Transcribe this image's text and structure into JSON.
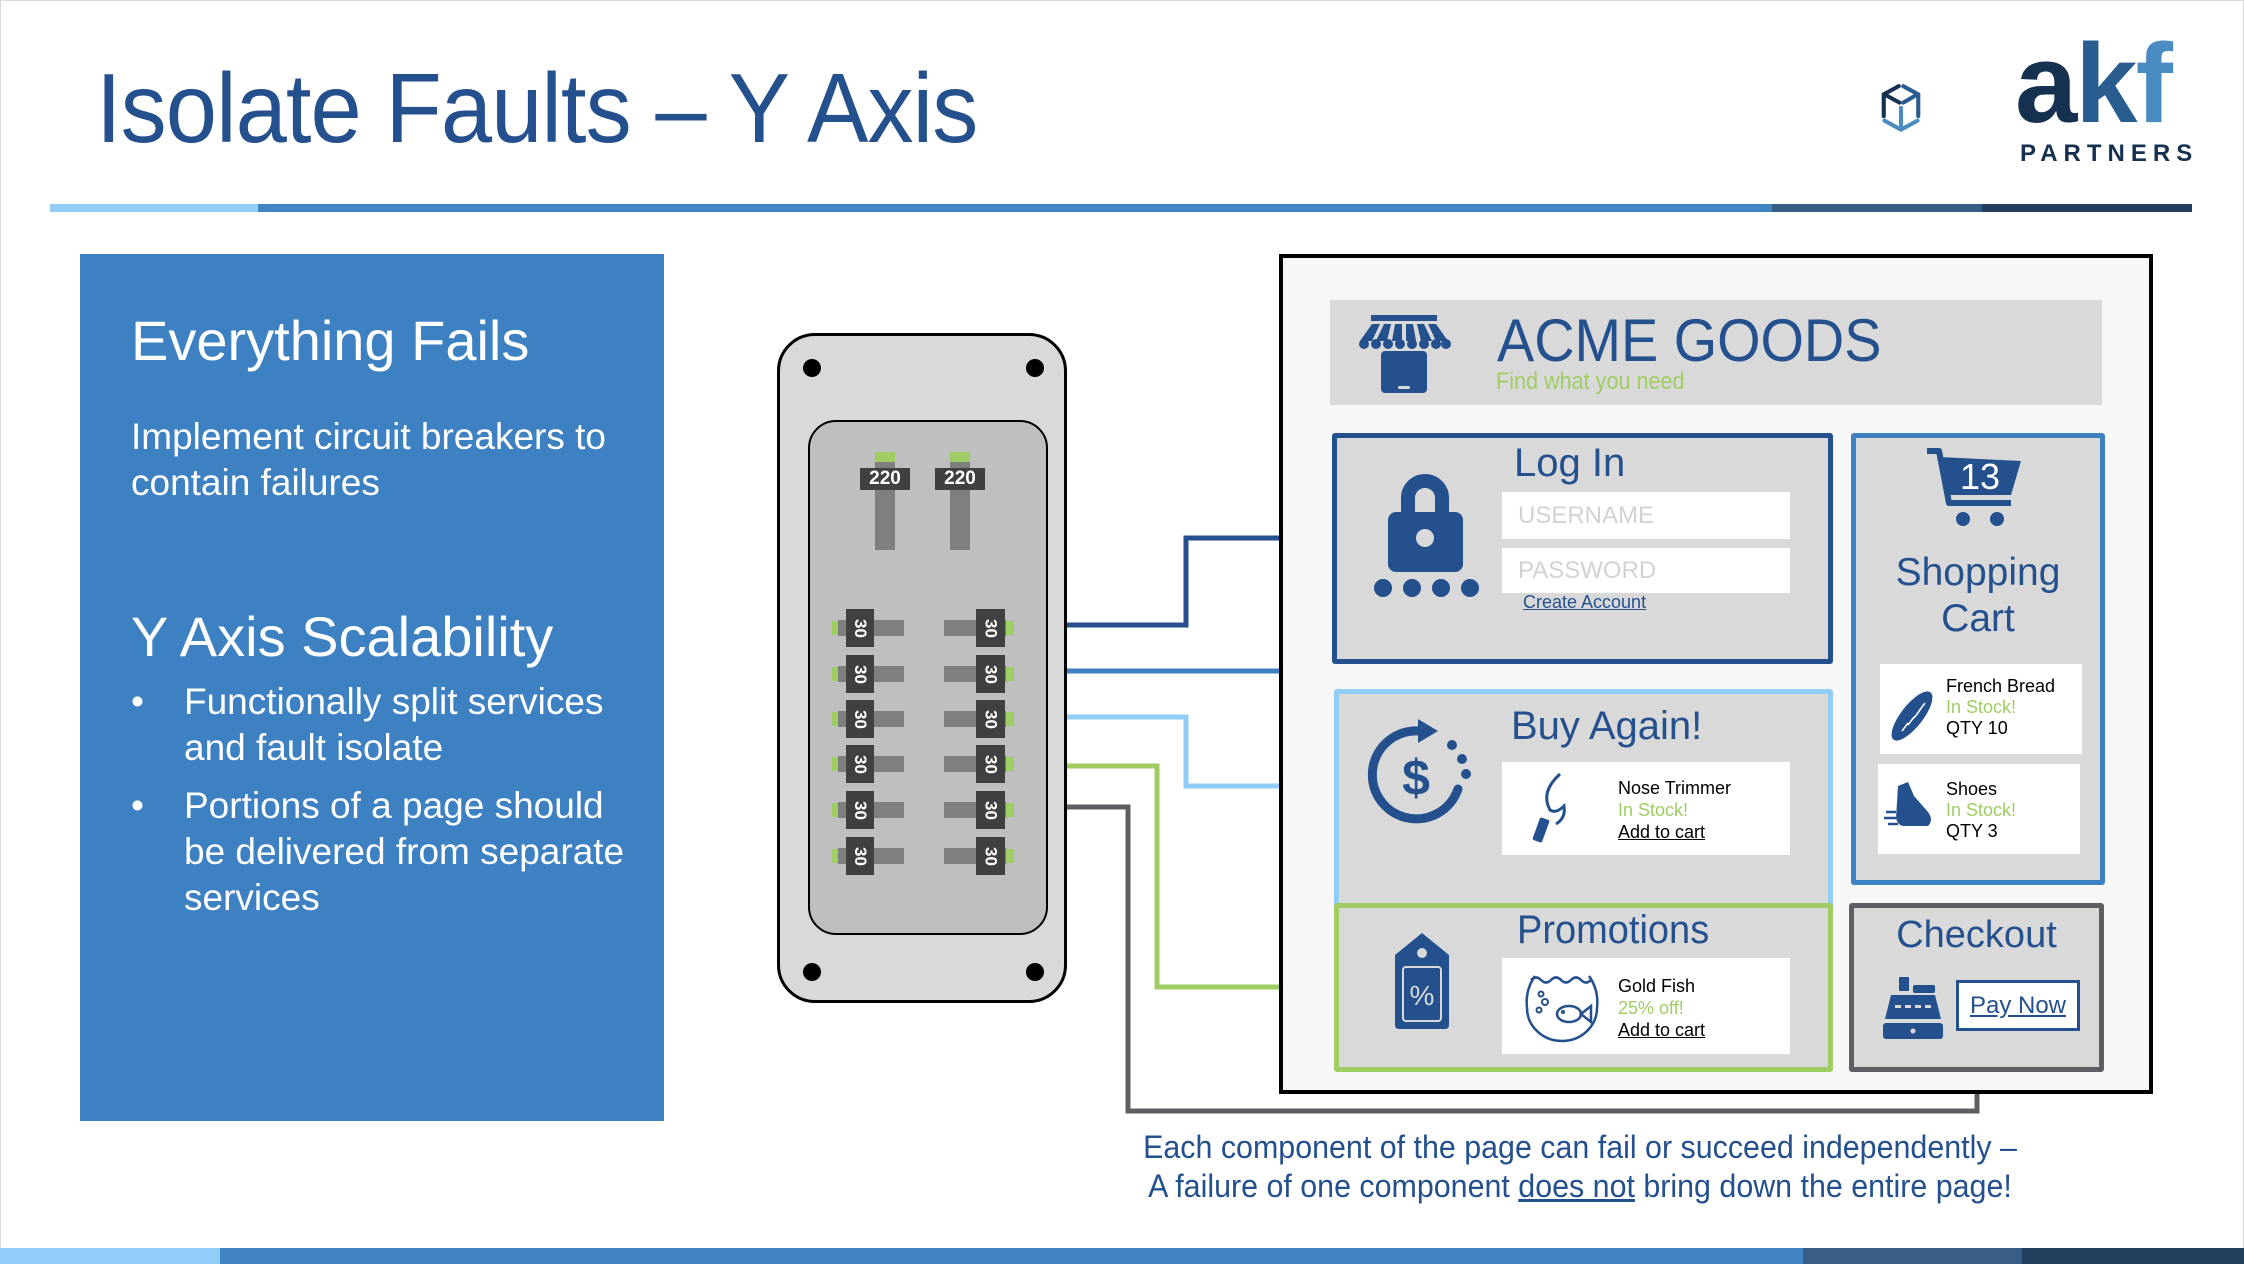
{
  "slide": {
    "title": "Isolate Faults – Y Axis",
    "logo": {
      "brand_a": "a",
      "brand_k": "k",
      "brand_f": "f",
      "subtitle": "PARTNERS",
      "icon": "cube-logo-icon"
    },
    "colors": {
      "title_blue": "#24508e",
      "panel_blue": "#3d81c3",
      "light_blue": "#92cdf7",
      "green": "#9fcd63",
      "gray": "#5f5f63",
      "dark_navy": "#243f5e",
      "steel_blue": "#375f86"
    }
  },
  "left_panel": {
    "heading1": "Everything Fails",
    "paragraph": "Implement circuit breakers to contain failures",
    "heading2": "Y Axis Scalability",
    "bullets": [
      "Functionally split services and fault isolate",
      "Portions of a page should be delivered from separate services"
    ],
    "bullet_glyph": "•"
  },
  "breaker_panel": {
    "main_breakers": [
      "220",
      "220"
    ],
    "left_column": [
      "30",
      "30",
      "30",
      "30",
      "30",
      "30"
    ],
    "right_column": [
      "30",
      "30",
      "30",
      "30",
      "30",
      "30"
    ]
  },
  "webpage": {
    "store_icon": "storefront-icon",
    "store_name": "ACME GOODS",
    "tagline": "Find what you need",
    "login": {
      "title": "Log In",
      "username_placeholder": "USERNAME",
      "password_placeholder": "PASSWORD",
      "create_account": "Create Account",
      "icon": "lock-icon"
    },
    "cart": {
      "count": "13",
      "title_line1": "Shopping",
      "title_line2": "Cart",
      "items": [
        {
          "name": "French Bread",
          "status": "In Stock!",
          "qty": "QTY 10",
          "icon": "bread-icon"
        },
        {
          "name": "Shoes",
          "status": "In Stock!",
          "qty": "QTY 3",
          "icon": "shoe-icon"
        }
      ]
    },
    "buy_again": {
      "title": "Buy Again!",
      "icon": "dollar-refresh-icon",
      "item": {
        "name": "Nose Trimmer",
        "status": "In Stock!",
        "action": "Add to cart",
        "icon": "nose-trimmer-icon"
      }
    },
    "promotions": {
      "title": "Promotions",
      "icon": "discount-tag-icon",
      "item": {
        "name": "Gold Fish",
        "status": "25% off!",
        "action": "Add to cart",
        "icon": "fishbowl-icon"
      }
    },
    "checkout": {
      "title": "Checkout",
      "icon": "cash-register-icon",
      "button": "Pay Now"
    }
  },
  "caption": {
    "line1": "Each component of the page can fail or succeed independently –",
    "line2_pre": "A failure of one component ",
    "line2_emph": "does not",
    "line2_post": " bring down the entire page!"
  }
}
